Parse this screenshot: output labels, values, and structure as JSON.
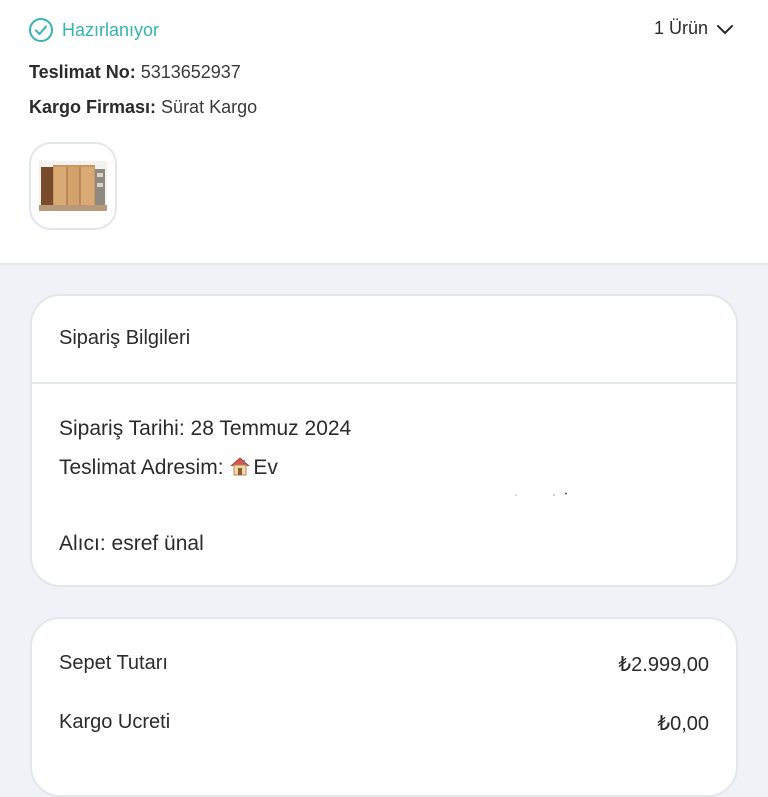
{
  "shipment": {
    "status": "Hazırlanıyor",
    "item_count": "1 Ürün",
    "tracking_label": "Teslimat No:",
    "tracking_value": "5313652937",
    "carrier_label": "Kargo Firması:",
    "carrier_value": "Sürat Kargo",
    "status_color": "#35b4b0",
    "status_icon": "check-circle-icon",
    "expand_icon": "chevron-down-icon",
    "product_image": "wardrobe-thumbnail"
  },
  "order_info": {
    "title": "Sipariş Bilgileri",
    "date_label": "Sipariş Tarihi:",
    "date_value": "28 Temmuz 2024",
    "address_label": "Teslimat Adresim:",
    "address_icon": "house-icon",
    "address_value": "Ev",
    "recipient_label": "Alıcı:",
    "recipient_value": "esref ünal"
  },
  "summary": {
    "basket_label": "Sepet Tutarı",
    "basket_value": "₺2.999,00",
    "shipping_label": "Kargo Ucreti",
    "shipping_value": "₺0,00"
  }
}
